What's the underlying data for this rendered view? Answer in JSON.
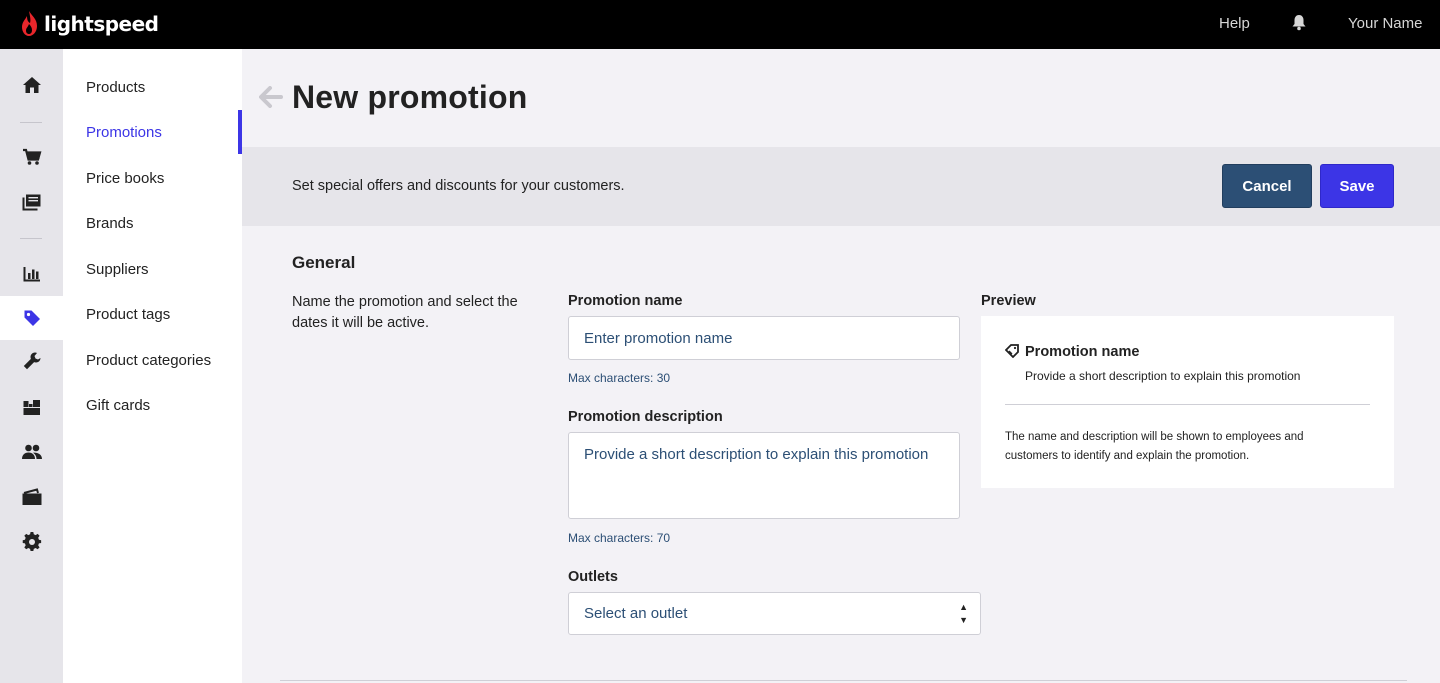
{
  "brand": {
    "name": "lightspeed",
    "flame_color": "#e8262b"
  },
  "topbar": {
    "help": "Help",
    "user": "Your Name"
  },
  "rail": {
    "items": [
      "home-icon",
      "cart-icon",
      "catalog-icon",
      "reports-icon",
      "tag-icon",
      "wrench-icon",
      "inventory-icon",
      "customers-icon",
      "wallet-icon",
      "gear-icon"
    ],
    "active": "tag-icon"
  },
  "subnav": {
    "items": [
      {
        "label": "Products"
      },
      {
        "label": "Promotions"
      },
      {
        "label": "Price books"
      },
      {
        "label": "Brands"
      },
      {
        "label": "Suppliers"
      },
      {
        "label": "Product tags"
      },
      {
        "label": "Product categories"
      },
      {
        "label": "Gift cards"
      }
    ],
    "active": "Promotions"
  },
  "header": {
    "title": "New promotion"
  },
  "band": {
    "text": "Set special offers and discounts for your customers.",
    "cancel": "Cancel",
    "save": "Save"
  },
  "general": {
    "title": "General",
    "description": "Name the promotion and select the dates it will be active.",
    "name_label": "Promotion name",
    "name_placeholder": "Enter promotion name",
    "name_hint": "Max characters: 30",
    "desc_label": "Promotion description",
    "desc_placeholder": "Provide a short description to explain this promotion",
    "desc_hint": "Max characters: 70",
    "outlets_label": "Outlets",
    "outlets_value": "Select an outlet"
  },
  "preview": {
    "label": "Preview",
    "name": "Promotion name",
    "description": "Provide a short description to explain this promotion",
    "note": "The name and description will be shown to employees and customers to identify and explain the promotion."
  },
  "colors": {
    "accent": "#3c35e6",
    "cancel": "#2c4f75",
    "topbar": "#000000"
  }
}
